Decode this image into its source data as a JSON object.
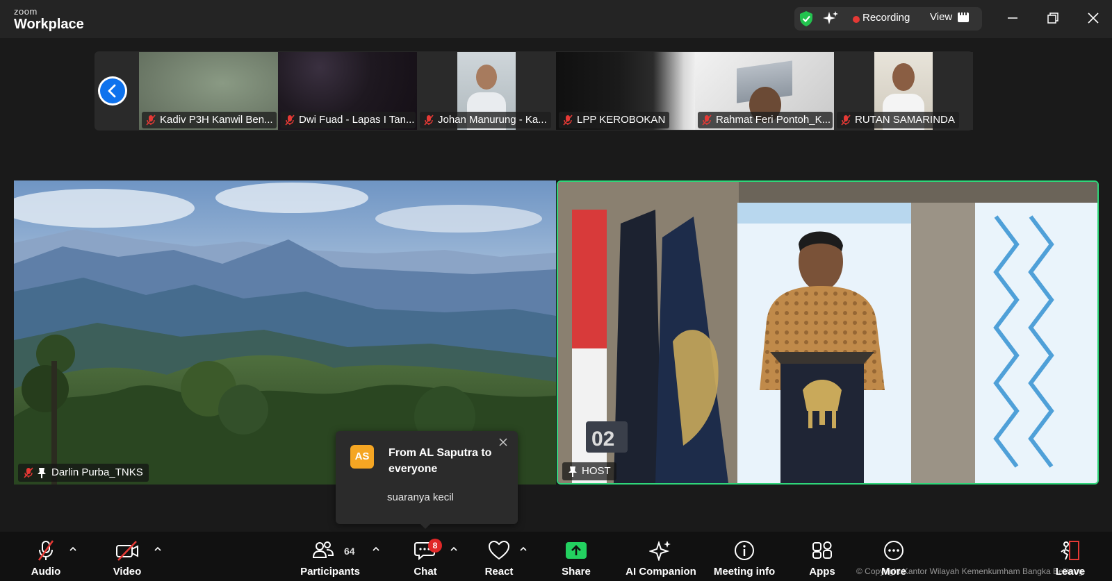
{
  "app": {
    "brand_small": "zoom",
    "brand_large": "Workplace"
  },
  "header": {
    "recording_label": "Recording",
    "view_label": "View"
  },
  "thumbnails": [
    {
      "name": "Kadiv P3H Kanwil Ben..."
    },
    {
      "name": "Dwi Fuad - Lapas I Tan..."
    },
    {
      "name": "Johan Manurung - Ka..."
    },
    {
      "name": "LPP KEROBOKAN"
    },
    {
      "name": "Rahmat Feri Pontoh_K..."
    },
    {
      "name": "RUTAN SAMARINDA"
    }
  ],
  "tiles": {
    "left": {
      "name": "Darlin Purba_TNKS"
    },
    "right": {
      "name": "HOST"
    }
  },
  "chat_toast": {
    "avatar_initials": "AS",
    "from": "From AL Saputra to everyone",
    "message": "suaranya kecil"
  },
  "toolbar": {
    "audio": "Audio",
    "video": "Video",
    "participants": "Participants",
    "participants_count": "64",
    "chat": "Chat",
    "chat_badge": "8",
    "react": "React",
    "share": "Share",
    "ai_companion": "AI Companion",
    "meeting_info": "Meeting info",
    "apps": "Apps",
    "more": "More",
    "leave": "Leave"
  },
  "watermark": "© Copyright Kantor Wilayah Kemenkumham Bangka Belitung",
  "colors": {
    "active_speaker": "#2fd67a",
    "recording": "#e53935",
    "badge": "#e02828",
    "avatar": "#f5a623",
    "share": "#23d160"
  }
}
